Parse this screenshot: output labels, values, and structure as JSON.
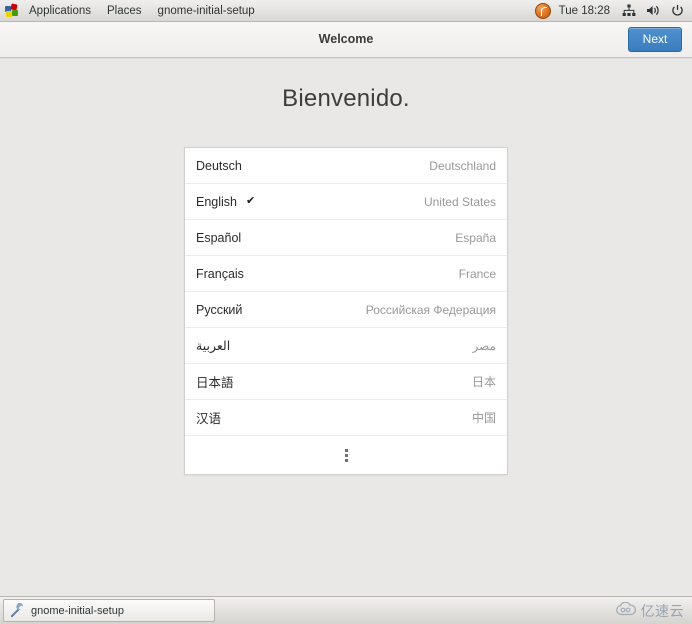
{
  "top_panel": {
    "apps_icon": "applications-grid-icon",
    "menus": [
      {
        "label": "Applications"
      },
      {
        "label": "Places"
      },
      {
        "label": "gnome-initial-setup"
      }
    ],
    "fedora_icon": "fedora-logo-icon",
    "clock": "Tue 18:28",
    "tray": [
      {
        "icon": "network-wired-icon"
      },
      {
        "icon": "volume-speaker-icon"
      },
      {
        "icon": "power-icon"
      }
    ]
  },
  "header": {
    "title": "Welcome",
    "next_label": "Next"
  },
  "main": {
    "welcome_title": "Bienvenido.",
    "languages": [
      {
        "name": "Deutsch",
        "country": "Deutschland",
        "selected": false,
        "rtl": false
      },
      {
        "name": "English",
        "country": "United States",
        "selected": true,
        "rtl": false
      },
      {
        "name": "Español",
        "country": "España",
        "selected": false,
        "rtl": false
      },
      {
        "name": "Français",
        "country": "France",
        "selected": false,
        "rtl": false
      },
      {
        "name": "Русский",
        "country": "Российская Федерация",
        "selected": false,
        "rtl": false
      },
      {
        "name": "العربية",
        "country": "مصر",
        "selected": false,
        "rtl": true
      },
      {
        "name": "日本語",
        "country": "日本",
        "selected": false,
        "rtl": false
      },
      {
        "name": "汉语",
        "country": "中国",
        "selected": false,
        "rtl": false
      }
    ],
    "check_glyph": "✔",
    "more_icon": "more-vertical-dots-icon"
  },
  "taskbar": {
    "window_label": "gnome-initial-setup",
    "window_icon": "gnome-initial-setup-icon",
    "watermark_text": "亿速云",
    "watermark_icon": "cloud-logo-icon"
  },
  "colors": {
    "accent_blue": "#3b7cbd",
    "panel_bg": "#e3e1df",
    "content_bg": "#e9e8e7",
    "list_bg": "#ffffff",
    "muted_text": "#989898"
  }
}
